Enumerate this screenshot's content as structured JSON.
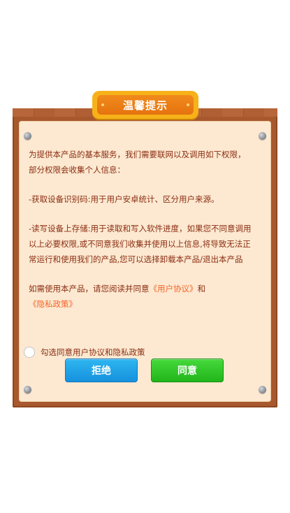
{
  "dialog": {
    "title": "温馨提示",
    "paragraph1": "为提供本产品的基本服务，我们需要联网以及调用如下权限，部分权限会收集个人信息：",
    "paragraph2": "-获取设备识别码:用于用户安卓统计、区分用户来源。",
    "paragraph3": "-读写设备上存储:用于读取和写入软件进度，如果您不同意调用以上必要权限,或不同意我们收集并使用以上信息,将导致无法正常运行和使用我们的产品,您可以选择卸载本产品/退出本产品",
    "paragraph4_prefix": "如需使用本产品，请您阅读并同意",
    "user_agreement_link": "《用户协议》",
    "and_text": "和",
    "privacy_policy_link": "《隐私政策》",
    "checkbox_label": "勾选同意用户协议和隐私政策",
    "checkbox_checked": false,
    "reject_label": "拒绝",
    "agree_label": "同意"
  },
  "colors": {
    "wood_frame": "#a8582d",
    "panel_bg": "#fde9d1",
    "text": "#8a2e12",
    "link": "#f2652a",
    "title_plate": "#f08a1c",
    "reject_button": "#1e9fe6",
    "agree_button": "#2cc324"
  }
}
